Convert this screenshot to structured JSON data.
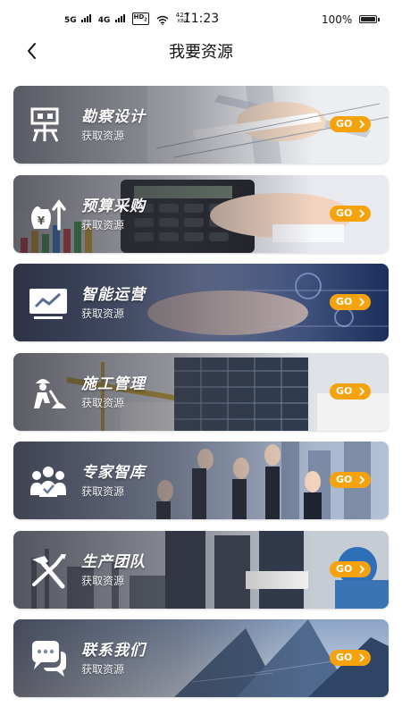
{
  "status_bar": {
    "network_5g": "5G",
    "network_4g": "4G",
    "hd": "HD",
    "hd_sub": "2",
    "speed_value": "42.7",
    "speed_unit": "KB/s",
    "time": "11:23",
    "battery": "100%"
  },
  "header": {
    "title": "我要资源",
    "back_icon": "chevron-left-icon"
  },
  "colors": {
    "accent": "#f6a20c",
    "card_text": "#ffffff"
  },
  "cards": [
    {
      "title": "勘察设计",
      "subtitle": "获取资源",
      "button": "GO",
      "icon": "survey-design-icon"
    },
    {
      "title": "预算采购",
      "subtitle": "获取资源",
      "button": "GO",
      "icon": "budget-money-icon"
    },
    {
      "title": "智能运营",
      "subtitle": "获取资源",
      "button": "GO",
      "icon": "monitor-chart-icon"
    },
    {
      "title": "施工管理",
      "subtitle": "获取资源",
      "button": "GO",
      "icon": "worker-icon"
    },
    {
      "title": "专家智库",
      "subtitle": "获取资源",
      "button": "GO",
      "icon": "experts-group-icon"
    },
    {
      "title": "生产团队",
      "subtitle": "获取资源",
      "button": "GO",
      "icon": "tools-icon"
    },
    {
      "title": "联系我们",
      "subtitle": "获取资源",
      "button": "GO",
      "icon": "chat-bubble-icon"
    }
  ]
}
